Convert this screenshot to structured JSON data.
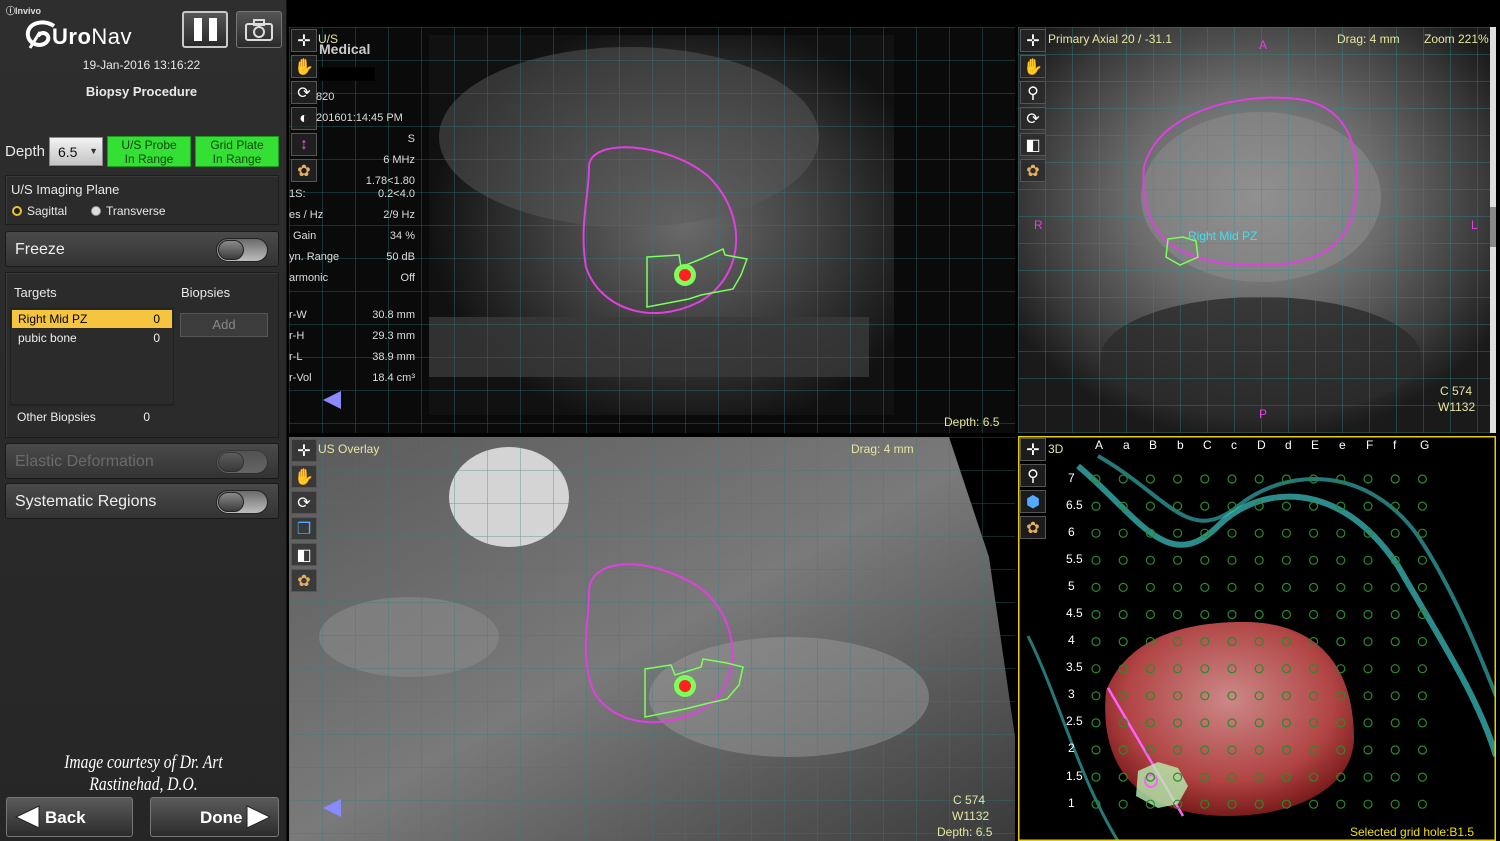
{
  "brand": {
    "company": "Invivo",
    "product_prefix": "Uro",
    "product_suffix": "Nav"
  },
  "header": {
    "datetime": "19-Jan-2016 13:16:22",
    "procedure": "Biopsy Procedure"
  },
  "depth": {
    "label": "Depth",
    "value": "6.5"
  },
  "status": {
    "probe": [
      "U/S Probe",
      "In Range"
    ],
    "grid_plate": [
      "Grid Plate",
      "In Range"
    ],
    "color": "#33e033"
  },
  "imaging_plane": {
    "title": "U/S Imaging Plane",
    "options": [
      "Sagittal",
      "Transverse"
    ],
    "selected": "Sagittal"
  },
  "toggles": {
    "freeze": "Freeze",
    "elastic": "Elastic Deformation",
    "systematic": "Systematic Regions"
  },
  "targets": {
    "header": "Targets",
    "biopsies_header": "Biopsies",
    "add_label": "Add",
    "items": [
      {
        "name": "Right Mid PZ",
        "count": "0",
        "selected": true
      },
      {
        "name": "pubic bone",
        "count": "0",
        "selected": false
      }
    ],
    "other": {
      "name": "Other Biopsies",
      "count": "0"
    }
  },
  "courtesy": "Image courtesy of Dr. Art Rastinehad, D.O.",
  "nav": {
    "back": "Back",
    "done": "Done"
  },
  "viewports": {
    "us": {
      "label": "U/S",
      "vendor": "Medical",
      "depth": "Depth: 6.5",
      "meta_left": [
        "820",
        "201601:14:45 PM",
        "",
        "",
        "1S:",
        "es / Hz",
        "Gain",
        "yn. Range",
        "armonic",
        "",
        "r-W",
        "r-H",
        "r-L",
        "r-Vol"
      ],
      "meta_right": [
        "",
        "",
        "S",
        "6 MHz",
        "1.78<1.80",
        "0.2<4.0",
        "2/9 Hz",
        "34 %",
        "50 dB",
        "Off",
        "30.8 mm",
        "29.3 mm",
        "38.9 mm",
        "18.4 cm³"
      ]
    },
    "axial": {
      "label": "Primary Axial 20 / -31.1",
      "drag": "Drag: 4 mm",
      "zoom": "Zoom 221%",
      "orient": {
        "top": "A",
        "bottom": "P",
        "left": "R",
        "right": "L"
      },
      "target_label": "Right Mid PZ",
      "c": "C 574",
      "w": "W1132"
    },
    "overlay": {
      "label": "US Overlay",
      "drag": "Drag: 4 mm",
      "c": "C 574",
      "w": "W1132",
      "depth": "Depth: 6.5"
    },
    "three_d": {
      "label": "3D",
      "grid_cols": [
        "A",
        "a",
        "B",
        "b",
        "C",
        "c",
        "D",
        "d",
        "E",
        "e",
        "F",
        "f",
        "G"
      ],
      "grid_rows": [
        "7",
        "6.5",
        "6",
        "5.5",
        "5",
        "4.5",
        "4",
        "3.5",
        "3",
        "2.5",
        "2",
        "1.5",
        "1"
      ],
      "selected_hole": "Selected grid hole:B1.5"
    }
  },
  "colors": {
    "prostate_contour": "#e040e0",
    "target_outline": "#7cff5a",
    "target_core": "#ff2020",
    "active_border": "#e8d000",
    "grid_line": "#3fa0a0"
  }
}
